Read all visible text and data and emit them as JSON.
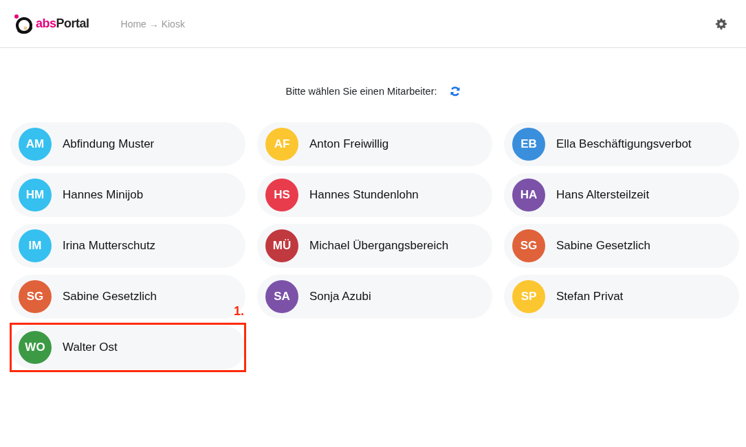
{
  "header": {
    "logo": {
      "prefix": "abs",
      "name": "Portal"
    },
    "breadcrumb": "Home → Kiosk"
  },
  "prompt": "Bitte wählen Sie einen Mitarbeiter:",
  "employees": [
    {
      "initials": "AM",
      "name": "Abfindung Muster",
      "color": "#35c0f0",
      "highlighted": false
    },
    {
      "initials": "AF",
      "name": "Anton Freiwillig",
      "color": "#fcc631",
      "highlighted": false
    },
    {
      "initials": "EB",
      "name": "Ella Beschäftigungsverbot",
      "color": "#3a8fdc",
      "highlighted": false
    },
    {
      "initials": "HM",
      "name": "Hannes Minijob",
      "color": "#35c0f0",
      "highlighted": false
    },
    {
      "initials": "HS",
      "name": "Hannes Stundenlohn",
      "color": "#e83c4c",
      "highlighted": false
    },
    {
      "initials": "HA",
      "name": "Hans Altersteilzeit",
      "color": "#7b52a8",
      "highlighted": false
    },
    {
      "initials": "IM",
      "name": "Irina Mutterschutz",
      "color": "#35c0f0",
      "highlighted": false
    },
    {
      "initials": "MÜ",
      "name": "Michael Übergangsbereich",
      "color": "#c0393f",
      "highlighted": false
    },
    {
      "initials": "SG",
      "name": "Sabine Gesetzlich",
      "color": "#e0623a",
      "highlighted": false
    },
    {
      "initials": "SG",
      "name": "Sabine Gesetzlich",
      "color": "#e0623a",
      "highlighted": false
    },
    {
      "initials": "SA",
      "name": "Sonja Azubi",
      "color": "#7b52a8",
      "highlighted": false
    },
    {
      "initials": "SP",
      "name": "Stefan Privat",
      "color": "#fcc631",
      "highlighted": false
    },
    {
      "initials": "WO",
      "name": "Walter Ost",
      "color": "#3c9a45",
      "highlighted": true
    }
  ],
  "annotation": {
    "label": "1."
  }
}
